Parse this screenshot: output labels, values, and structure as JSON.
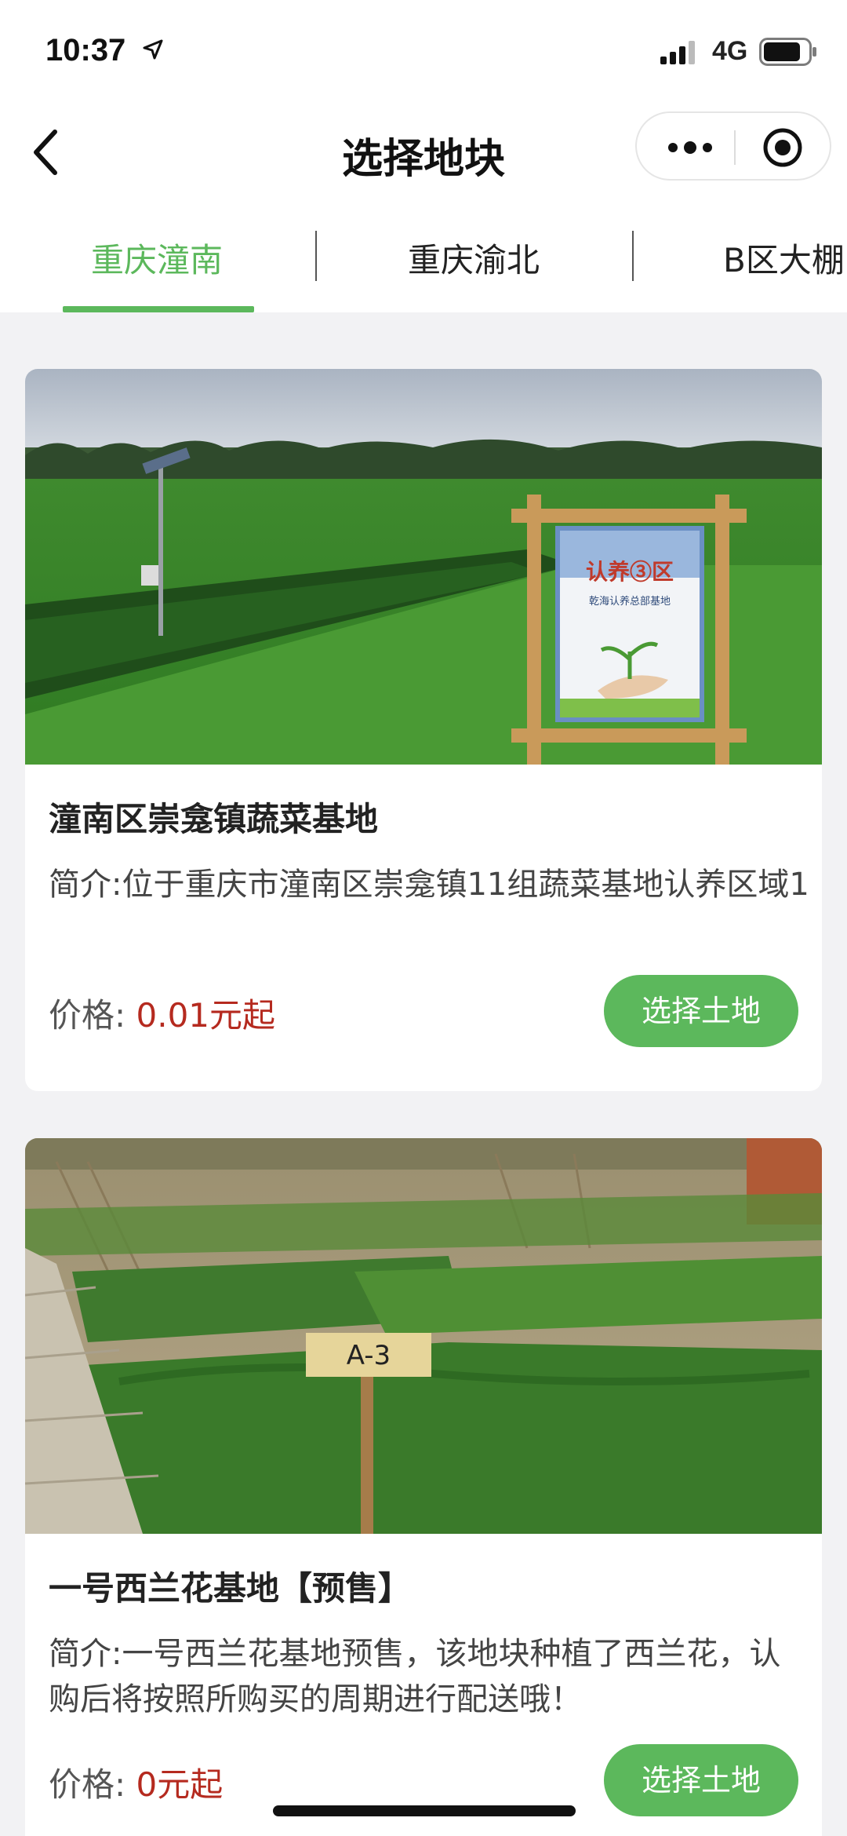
{
  "status_bar": {
    "time": "10:37",
    "network": "4G"
  },
  "nav": {
    "title": "选择地块"
  },
  "tabs": [
    {
      "label": "重庆潼南",
      "active": true
    },
    {
      "label": "重庆渝北",
      "active": false
    },
    {
      "label": "B区大棚",
      "active": false
    }
  ],
  "cards": [
    {
      "title": "潼南区崇龛镇蔬菜基地",
      "desc": "简介:位于重庆市潼南区崇龛镇11组蔬菜基地认养区域1",
      "price_label": "价格:",
      "price_value": "0.01元起",
      "button": "选择土地",
      "sign_text": "认养③区",
      "sign_sub": "乾海认养总部基地"
    },
    {
      "title": "一号西兰花基地【预售】",
      "desc": "简介:一号西兰花基地预售，该地块种植了西兰花，认购后将按照所购买的周期进行配送哦！",
      "price_label": "价格:",
      "price_value": "0元起",
      "button": "选择土地",
      "sign_text": "A-3"
    }
  ],
  "colors": {
    "accent": "#5cb85c",
    "price": "#b52a1f"
  },
  "icons": [
    "location-arrow-icon",
    "signal-icon",
    "battery-icon",
    "back-icon",
    "more-icon",
    "close-target-icon"
  ]
}
